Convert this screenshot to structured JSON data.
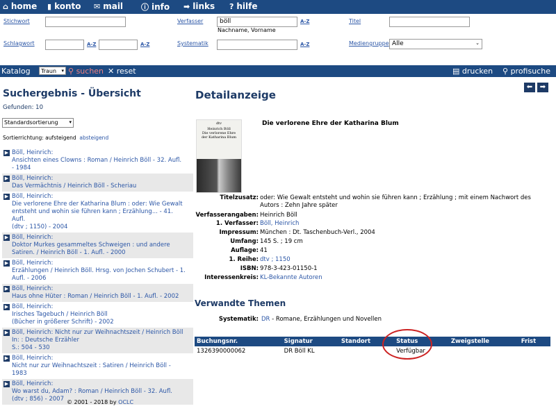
{
  "topnav": {
    "home": "home",
    "konto": "konto",
    "mail": "mail",
    "info": "info",
    "links": "links",
    "hilfe": "hilfe",
    "icons": {
      "home": "house-icon",
      "konto": "account-icon",
      "mail": "mail-icon",
      "info": "info-icon",
      "links": "arrow-right-icon",
      "hilfe": "question-icon"
    }
  },
  "search": {
    "stichwort": "Stichwort",
    "verfasser": "Verfasser",
    "titel": "Titel",
    "verfasser_value": "böll",
    "verfasser_hint": "Nachname, Vorname",
    "schlagwort": "Schlagwort",
    "systematik": "Systematik",
    "mediengruppe": "Mediengruppe",
    "mediengruppe_value": "Alle",
    "az": "A-Z"
  },
  "catbar": {
    "katalog": "Katalog",
    "branch": "Traun",
    "suchen": "suchen",
    "reset": "reset",
    "drucken": "drucken",
    "profisuche": "profisuche"
  },
  "results": {
    "title": "Suchergebnis - Übersicht",
    "found": "Gefunden: 10",
    "sort": "Standardsortierung",
    "direction_label": "Sortierrichtung: aufsteigend",
    "direction_link": "absteigend",
    "items": [
      {
        "lines": [
          "Böll, Heinrich:",
          "Ansichten eines Clowns : Roman / Heinrich Böll - 32. Aufl.",
          "- 1984"
        ]
      },
      {
        "lines": [
          "Böll, Heinrich:",
          "Das Vermächtnis / Heinrich Böll - Scheriau"
        ]
      },
      {
        "lines": [
          "Böll, Heinrich:",
          "Die verlorene Ehre der Katharina Blum : oder: Wie Gewalt",
          "entsteht und wohin sie führen kann ; Erzählung... - 41.",
          "Aufl.",
          "(dtv ; 1150) - 2004"
        ]
      },
      {
        "lines": [
          "Böll, Heinrich:",
          "Doktor Murkes gesammeltes Schweigen : und andere",
          "Satiren. / Heinrich Böll - 1. Aufl. - 2000"
        ]
      },
      {
        "lines": [
          "Böll, Heinrich:",
          "Erzählungen / Heinrich Böll. Hrsg. von Jochen Schubert - 1.",
          "Aufl. - 2006"
        ]
      },
      {
        "lines": [
          "Böll, Heinrich:",
          "Haus ohne Hüter : Roman / Heinrich Böll - 1. Aufl. - 2002"
        ]
      },
      {
        "lines": [
          "Böll, Heinrich:",
          "Irisches Tagebuch / Heinrich Böll",
          "(Bücher in größerer Schrift) - 2002"
        ]
      },
      {
        "lines": [
          "Böll, Heinrich: Nicht nur zur Weihnachtszeit / Heinrich Böll",
          "In: :  Deutsche Erzähler",
          "S.: 504 - 530"
        ]
      },
      {
        "lines": [
          "Böll, Heinrich:",
          "Nicht nur zur Weihnachtszeit : Satiren / Heinrich Böll -",
          "1983"
        ]
      },
      {
        "lines": [
          "Böll, Heinrich:",
          "Wo warst du, Adam? : Roman / Heinrich Böll - 32. Aufl.",
          "(dtv ; 856) - 2007"
        ]
      }
    ]
  },
  "detail": {
    "title": "Detailanzeige",
    "book_title": "Die verlorene Ehre der Katharina Blum",
    "cover": {
      "publisher": "dtv",
      "author": "Heinrich Böll",
      "title": "Die verlorene Ehre der Katharina Blum"
    },
    "fields": [
      {
        "key": "Titelzusatz:",
        "value": "oder: Wie Gewalt entsteht und wohin sie führen kann ; Erzählung ; mit einem Nachwort des Autors : Zehn Jahre später",
        "link": false
      },
      {
        "key": "Verfasserangaben:",
        "value": "Heinrich Böll",
        "link": false
      },
      {
        "key": "1. Verfasser:",
        "value": "Böll, Heinrich",
        "link": true
      },
      {
        "key": "Impressum:",
        "value": "München : Dt. Taschenbuch-Verl., 2004",
        "link": false
      },
      {
        "key": "Umfang:",
        "value": "145 S. ; 19 cm",
        "link": false
      },
      {
        "key": "Auflage:",
        "value": "41",
        "link": false
      },
      {
        "key": "1. Reihe:",
        "value": "dtv ; 1150",
        "link": true
      },
      {
        "key": "ISBN:",
        "value": "978-3-423-01150-1",
        "link": false
      },
      {
        "key": "Interessenkreis:",
        "value": "KL-Bekannte Autoren",
        "link": true
      }
    ],
    "related_title": "Verwandte Themen",
    "systematik_key": "Systematik:",
    "systematik_code": "DR",
    "systematik_text": " - Romane, Erzählungen und Novellen"
  },
  "status_table": {
    "headers": [
      "Buchungsnr.",
      "Signatur",
      "Standort",
      "Status",
      "Zweigstelle",
      "Frist"
    ],
    "rows": [
      [
        "1326390000062",
        "DR Böll KL",
        "",
        "Verfügbar",
        "",
        ""
      ]
    ]
  },
  "footer": {
    "text": "© 2001 - 2018 by ",
    "link": "OCLC"
  }
}
